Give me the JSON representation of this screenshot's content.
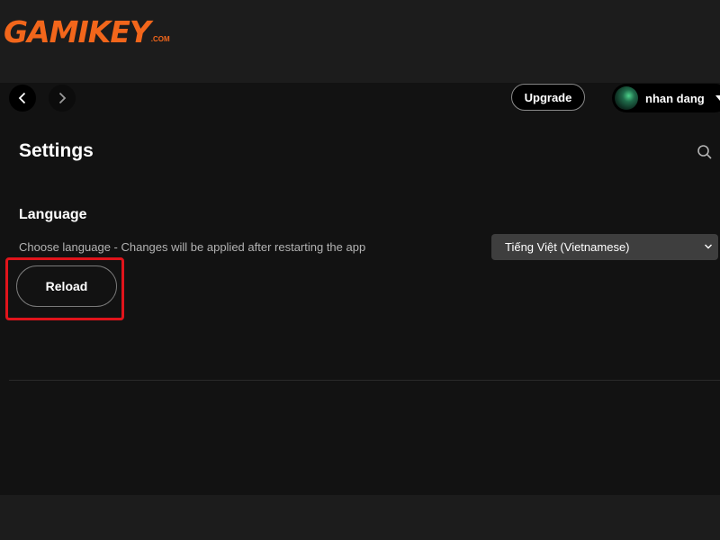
{
  "watermark": {
    "logo_text": "GAMIKEY",
    "logo_suffix": ".COM"
  },
  "topbar": {
    "back_icon": "chevron-left-icon",
    "forward_icon": "chevron-right-icon",
    "upgrade_label": "Upgrade",
    "user": {
      "name": "nhan dang",
      "caret_icon": "caret-down-icon"
    }
  },
  "page": {
    "title": "Settings",
    "search_icon": "search-icon"
  },
  "language": {
    "heading": "Language",
    "description": "Choose language - Changes will be applied after restarting the app",
    "selected": "Tiếng Việt (Vietnamese)",
    "reload_label": "Reload"
  },
  "colors": {
    "background": "#121212",
    "highlight": "#e0141b",
    "logo": "#f2661b",
    "select_bg": "#3e3e3e"
  }
}
